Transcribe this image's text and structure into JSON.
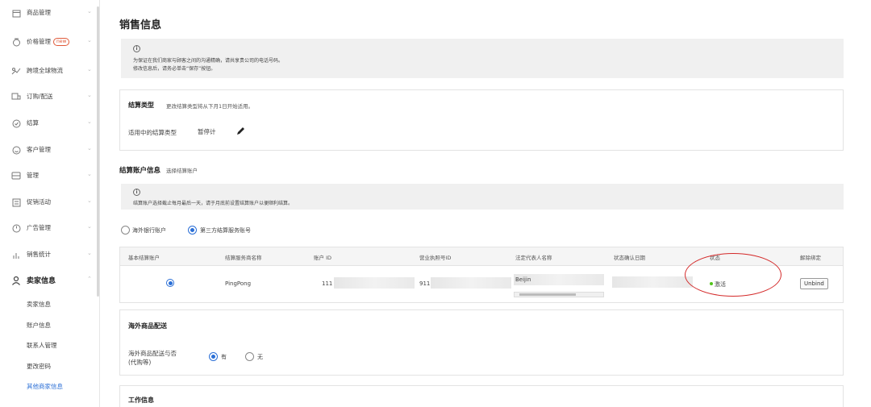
{
  "sidebar": {
    "items": [
      {
        "label": "商品管理",
        "icon": "product-icon"
      },
      {
        "label": "价格管理",
        "badge": "new",
        "icon": "price-tag-icon"
      },
      {
        "label": "跨境全球物流",
        "icon": "logistics-icon"
      },
      {
        "label": "订购/配送",
        "icon": "order-icon"
      },
      {
        "label": "结算",
        "icon": "settlement-icon"
      },
      {
        "label": "客户管理",
        "icon": "customer-icon"
      },
      {
        "label": "管理",
        "icon": "manage-icon"
      },
      {
        "label": "促销活动",
        "icon": "promotion-icon"
      },
      {
        "label": "广告管理",
        "icon": "ad-icon"
      },
      {
        "label": "销售统计",
        "icon": "stats-icon"
      },
      {
        "label": "卖家信息",
        "icon": "user-icon"
      }
    ],
    "sub_items": [
      "卖家信息",
      "账户信息",
      "联系人管理",
      "更改密码",
      "其他商家信息"
    ]
  },
  "page": {
    "title": "销售信息",
    "notice": {
      "line1": "为保证在我们商家与顾客之间的沟通精确，请共享贵公司的电话号码。",
      "line2": "修改信息后，请务必单击“保存”按钮。"
    }
  },
  "settlement_type": {
    "title": "结算类型",
    "note": "更改结算类型将从下月1日开始适用。",
    "label": "适用中的结算类型",
    "value": "暂停计"
  },
  "settlement_account": {
    "title": "结算账户信息",
    "subtitle": "选择结算账户",
    "notice": "结算账户选择截止每月最后一天，请于月底前设置结算账户以便顺利结算。",
    "options": [
      {
        "label": "海外银行账户",
        "selected": false
      },
      {
        "label": "第三方结算服务账号",
        "selected": true
      }
    ],
    "table": {
      "headers": [
        "基本结算账户",
        "结算服务商名称",
        "账户 ID",
        "营业执照号ID",
        "法定代表人名称",
        "状态确认日期",
        "状态",
        "解除绑定"
      ],
      "row": {
        "provider": "PingPong",
        "account_id": "111",
        "license_id": "911",
        "representative": "Beijin",
        "status": "激活",
        "unbind_label": "Unbind"
      }
    }
  },
  "overseas": {
    "title": "海外商品配送",
    "label_line1": "海外商品配送与否",
    "label_line2": "(代购等)",
    "options": [
      {
        "label": "有",
        "selected": true
      },
      {
        "label": "无",
        "selected": false
      }
    ]
  },
  "work_info": {
    "title": "工作信息"
  },
  "colors": {
    "accent": "#2b6fd6",
    "active_status": "#52c41a",
    "annotation": "#d42a2a"
  }
}
